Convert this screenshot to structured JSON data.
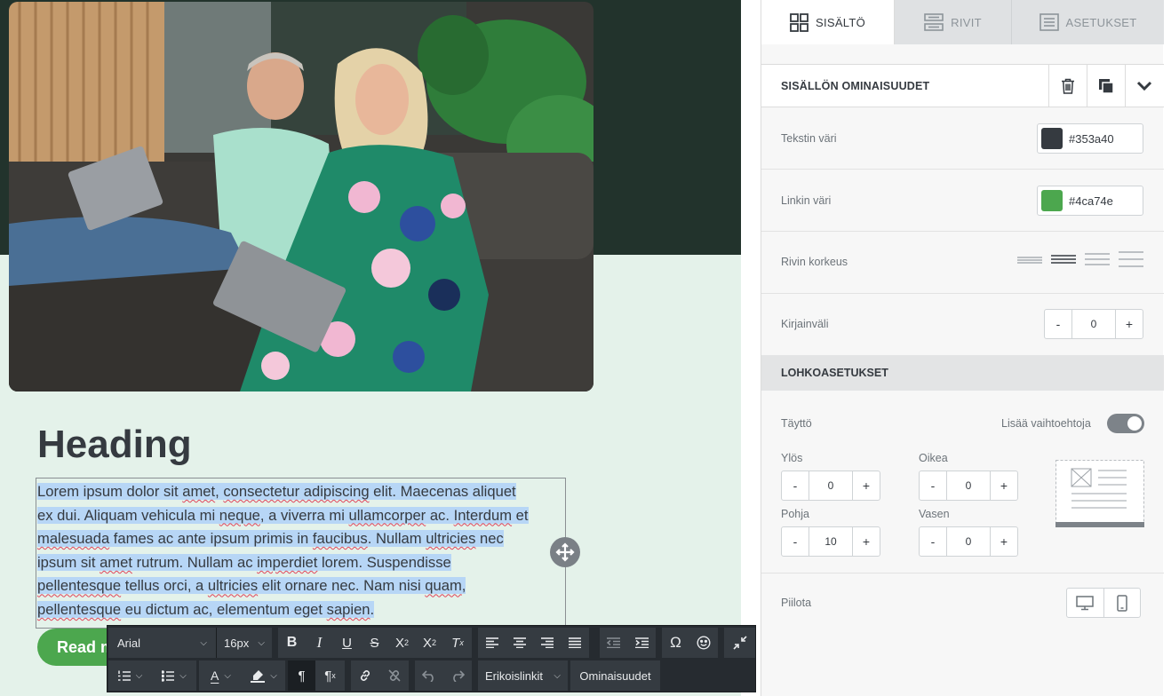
{
  "canvas": {
    "heading": "Heading",
    "paragraph_lines": [
      [
        [
          "Lorem ipsum dolor sit ",
          ""
        ],
        [
          "amet",
          "sq"
        ],
        [
          ", ",
          ""
        ],
        [
          "consectetur adipiscing",
          "sq"
        ],
        [
          " elit. Maecenas aliquet",
          ""
        ]
      ],
      [
        [
          "ex dui. Aliquam vehicula mi ",
          ""
        ],
        [
          "neque",
          "sq"
        ],
        [
          ", a viverra mi ",
          ""
        ],
        [
          "ullamcorper",
          "sq"
        ],
        [
          " ac. ",
          ""
        ],
        [
          "Interdum",
          "sq"
        ],
        [
          " et",
          ""
        ]
      ],
      [
        [
          "malesuada",
          "sq"
        ],
        [
          " fames ac ante ipsum primis in ",
          ""
        ],
        [
          "faucibus",
          "sq"
        ],
        [
          ". Nullam ",
          ""
        ],
        [
          "ultricies",
          "sq"
        ],
        [
          " nec",
          ""
        ]
      ],
      [
        [
          "ipsum sit ",
          ""
        ],
        [
          "amet",
          "sq"
        ],
        [
          " rutrum. Nullam ac ",
          ""
        ],
        [
          "imperdiet",
          "sq"
        ],
        [
          " lorem. Suspendisse",
          ""
        ]
      ],
      [
        [
          "pellentesque",
          "sq"
        ],
        [
          " tellus orci, a ",
          ""
        ],
        [
          "ultricies",
          "sq"
        ],
        [
          " elit ornare nec. Nam nisi ",
          ""
        ],
        [
          "quam",
          "sq"
        ],
        [
          ",",
          ""
        ]
      ],
      [
        [
          "pellentesque",
          "sq"
        ],
        [
          " eu dictum ac, elementum eget ",
          ""
        ],
        [
          "sapien",
          "sq"
        ],
        [
          ".",
          ""
        ]
      ]
    ],
    "button_label": "Read more",
    "colors": {
      "hero_bg": "#22332c",
      "section_bg": "#e4f2ea",
      "text": "#353a40",
      "button": "#4ca74e",
      "selection": "#b7d6f6"
    }
  },
  "toolbar": {
    "font_family": "Arial",
    "font_size": "16px",
    "special_links": "Erikoislinkit",
    "properties": "Ominaisuudet",
    "icons": [
      "bold-icon",
      "italic-icon",
      "underline-icon",
      "strikethrough-icon",
      "superscript-icon",
      "subscript-icon",
      "clear-format-icon",
      "align-left-icon",
      "align-center-icon",
      "align-right-icon",
      "align-justify-icon",
      "outdent-icon",
      "indent-icon",
      "special-char-icon",
      "emoji-icon",
      "collapse-icon",
      "ordered-list-icon",
      "bullet-list-icon",
      "text-color-icon",
      "highlight-icon",
      "ltr-icon",
      "rtl-icon",
      "link-icon",
      "unlink-icon",
      "undo-icon",
      "redo-icon"
    ]
  },
  "panel": {
    "tabs": [
      {
        "label": "SISÄLTÖ",
        "icon": "grid-icon",
        "active": true
      },
      {
        "label": "RIVIT",
        "icon": "rows-icon",
        "active": false
      },
      {
        "label": "ASETUKSET",
        "icon": "settings-doc-icon",
        "active": false
      }
    ],
    "header_title": "SISÄLLÖN OMINAISUUDET",
    "text_color_label": "Tekstin väri",
    "text_color_value": "#353a40",
    "link_color_label": "Linkin väri",
    "link_color_value": "#4ca74e",
    "line_height_label": "Rivin korkeus",
    "letter_spacing_label": "Kirjainväli",
    "letter_spacing_value": "0",
    "block_settings_title": "LOHKOASETUKSET",
    "padding_label": "Täyttö",
    "more_options_label": "Lisää vaihtoehtoja",
    "more_options_on": true,
    "padding": {
      "top_label": "Ylös",
      "top_value": "0",
      "right_label": "Oikea",
      "right_value": "0",
      "bottom_label": "Pohja",
      "bottom_value": "10",
      "left_label": "Vasen",
      "left_value": "0"
    },
    "hide_label": "Piilota",
    "minus": "-",
    "plus": "+"
  }
}
